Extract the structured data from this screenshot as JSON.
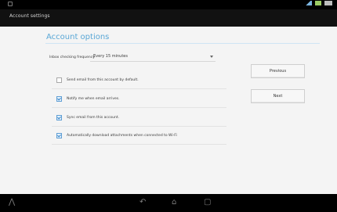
{
  "window": {
    "action_bar_title": "Account settings"
  },
  "content": {
    "heading": "Account options",
    "frequency": {
      "label": "Inbox checking frequency",
      "value": "Every 15 minutes"
    },
    "options": [
      {
        "label": "Send email from this account by default.",
        "checked": false
      },
      {
        "label": "Notify me when email arrives.",
        "checked": true
      },
      {
        "label": "Sync email from this account.",
        "checked": true
      },
      {
        "label": "Automatically download attachments when connected to Wi-Fi",
        "checked": true
      }
    ],
    "buttons": {
      "previous": "Previous",
      "next": "Next"
    }
  },
  "navigation": {
    "back_icon": "↶",
    "home_icon": "⌂",
    "recent_icon": "▢",
    "menu_icon": "⋀"
  },
  "colors": {
    "heading": "#5aa7d6",
    "status_bar": "#000000",
    "action_bar": "#111111"
  }
}
